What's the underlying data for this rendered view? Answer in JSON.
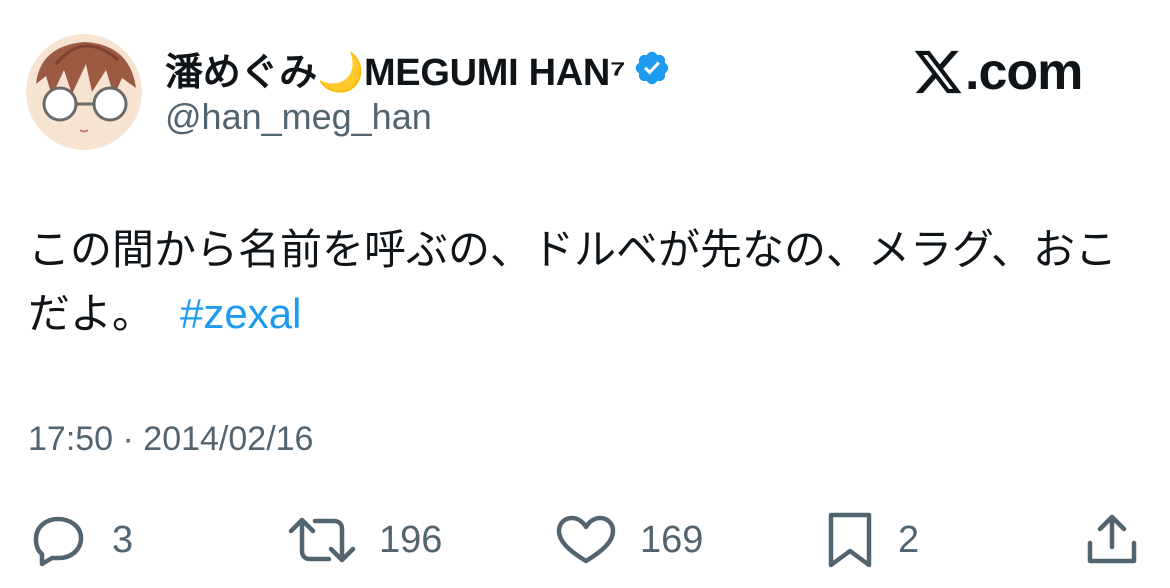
{
  "author": {
    "display_name": "潘めぐみ🌙MEGUMI HAN⁷",
    "handle": "@han_meg_han",
    "verified": true
  },
  "brand": {
    "dotcom": ".com"
  },
  "tweet": {
    "text": "この間から名前を呼ぶの、ドルベが先なの、メラグ、おこだよ。",
    "hashtag": "#zexal",
    "timestamp": "17:50 · 2014/02/16"
  },
  "metrics": {
    "replies": "3",
    "retweets": "196",
    "likes": "169",
    "bookmarks": "2"
  },
  "colors": {
    "text": "#0f1419",
    "secondary": "#536471",
    "accent": "#1d9bf0"
  },
  "icons": {
    "verified": "verified-badge-icon",
    "reply": "reply-icon",
    "retweet": "retweet-icon",
    "like": "heart-icon",
    "bookmark": "bookmark-icon",
    "share": "share-icon"
  }
}
